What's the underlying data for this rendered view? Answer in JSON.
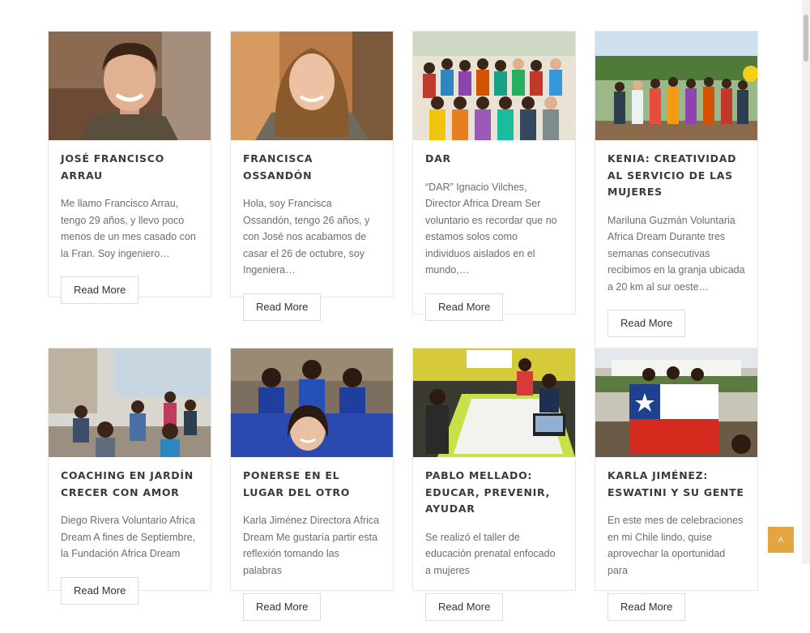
{
  "posts": [
    {
      "title": "JOSÉ FRANCISCO ARRAU",
      "excerpt": "Me llamo Francisco Arrau, tengo 29 años, y llevo poco menos de un mes casado con la Fran. Soy ingeniero…",
      "read_more": "Read More"
    },
    {
      "title": "FRANCISCA OSSANDÓN",
      "excerpt": "Hola, soy Francisca Ossandón, tengo 26 años, y con José nos acabamos de casar el 26 de octubre, soy Ingeniera…",
      "read_more": "Read More"
    },
    {
      "title": "DAR",
      "excerpt": "“DAR” Ignacio Vilches, Director Africa Dream Ser voluntario es recordar que no estamos solos como individuos aislados en el mundo,…",
      "read_more": "Read More"
    },
    {
      "title": "KENIA: CREATIVIDAD AL SERVICIO DE LAS MUJERES",
      "excerpt": "Mariluna Guzmán Voluntaria Africa Dream Durante tres semanas consecutivas recibimos en la granja ubicada a 20 km al sur oeste…",
      "read_more": "Read More"
    },
    {
      "title": "COACHING EN JARDÍN CRECER CON AMOR",
      "excerpt": "Diego Rivera Voluntario Africa Dream   A fines de Septiembre, la Fundación Africa Dream",
      "read_more": "Read More"
    },
    {
      "title": "PONERSE EN EL LUGAR DEL OTRO",
      "excerpt": "Karla Jiménez Directora Africa Dream Me gustaría partir esta reflexión tomando las palabras",
      "read_more": "Read More"
    },
    {
      "title": "PABLO MELLADO: EDUCAR, PREVENIR, AYUDAR",
      "excerpt": "Se realizó el taller de educación prenatal enfocado a mujeres",
      "read_more": "Read More"
    },
    {
      "title": "KARLA JIMÉNEZ: ESWATINI Y SU GENTE",
      "excerpt": "En este mes de celebraciones en mi Chile lindo, quise aprovechar la oportunidad para",
      "read_more": "Read More"
    }
  ],
  "scroll_top": {
    "icon": "chevron-up-icon",
    "glyph": "˄"
  },
  "colors": {
    "accent": "#e2a53f",
    "title": "#3b3b3b",
    "excerpt": "#6d6d6d",
    "border": "#e6e6e6"
  }
}
